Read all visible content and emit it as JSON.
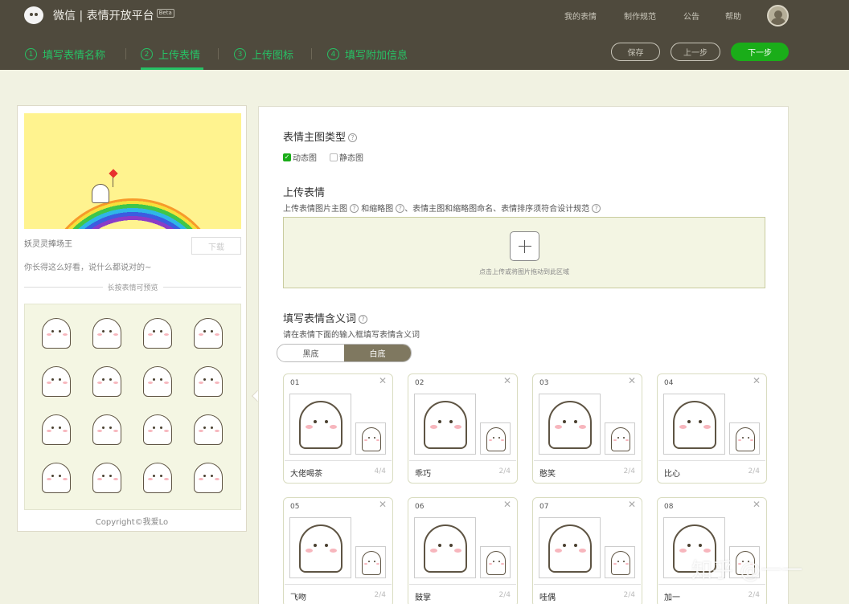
{
  "brand": {
    "title": "微信 | 表情开放平台",
    "badge": "Beta"
  },
  "topnav": [
    "我的表情",
    "制作规范",
    "公告",
    "帮助"
  ],
  "steps": [
    {
      "num": "1",
      "label": "填写表情名称"
    },
    {
      "num": "2",
      "label": "上传表情"
    },
    {
      "num": "3",
      "label": "上传图标"
    },
    {
      "num": "4",
      "label": "填写附加信息"
    }
  ],
  "active_step": "2",
  "actions": {
    "save": "保存",
    "prev": "上一步",
    "next": "下一步"
  },
  "preview": {
    "name": "妖灵灵捧场王",
    "download": "下载",
    "desc": "你长得这么好看，说什么都说对的~",
    "long_press": "长按表情可预览",
    "copyright": "Copyright©我爱Lo",
    "grid_count": 16
  },
  "main": {
    "type_title": "表情主图类型",
    "type_options": [
      {
        "label": "动态图",
        "checked": true
      },
      {
        "label": "静态图",
        "checked": false
      }
    ],
    "upload_title": "上传表情",
    "upload_hint_1": "上传表情图片主图",
    "upload_hint_2": "和缩略图",
    "upload_hint_3": "、表情主图和缩略图命名、表情排序须符合设计规范",
    "upload_tip": "点击上传或将图片拖动到此区域",
    "meaning_title": "填写表情含义词",
    "meaning_hint": "请在表情下面的输入框填写表情含义词",
    "bg_toggle": [
      {
        "label": "黑底",
        "active": false
      },
      {
        "label": "白底",
        "active": true
      }
    ]
  },
  "cards": [
    {
      "num": "01",
      "word": "大佬喝茶",
      "count": "4/4"
    },
    {
      "num": "02",
      "word": "乖巧",
      "count": "2/4"
    },
    {
      "num": "03",
      "word": "憨笑",
      "count": "2/4"
    },
    {
      "num": "04",
      "word": "比心",
      "count": "2/4"
    },
    {
      "num": "05",
      "word": "飞吻",
      "count": "2/4"
    },
    {
      "num": "06",
      "word": "鼓掌",
      "count": "2/4"
    },
    {
      "num": "07",
      "word": "哇偶",
      "count": "2/4"
    },
    {
      "num": "08",
      "word": "加一",
      "count": "2/4"
    }
  ],
  "watermark": "知乎 @一一",
  "colors": {
    "accent": "#1aad19",
    "header_bg": "#4f4a3d",
    "page_bg": "#f1f2e2"
  }
}
